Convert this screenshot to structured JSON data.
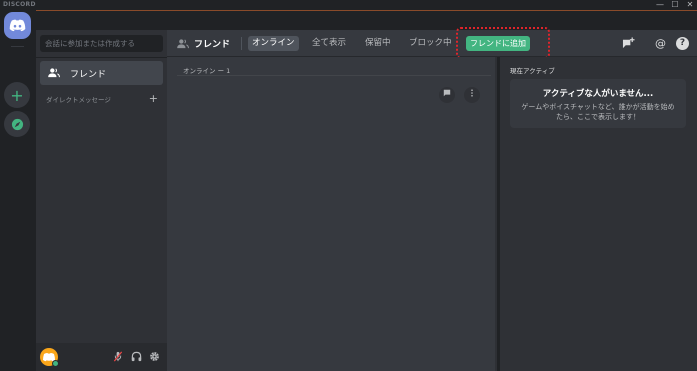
{
  "window": {
    "brand": "DISCORD",
    "minimize": "—",
    "maximize": "☐",
    "close": "✕"
  },
  "rail": {
    "add_server": "+",
    "explore": "⊘"
  },
  "sidebar": {
    "search_placeholder": "会話に参加または作成する",
    "friends_label": "フレンド",
    "dm_header": "ダイレクトメッセージ",
    "dm_add": "+"
  },
  "header": {
    "title": "フレンド",
    "tabs": [
      {
        "label": "オンライン",
        "active": true
      },
      {
        "label": "全て表示",
        "active": false
      },
      {
        "label": "保留中",
        "active": false
      },
      {
        "label": "ブロック中",
        "active": false
      }
    ],
    "add_friend": "フレンドに追加",
    "mention_icon": "@",
    "help_icon": "?"
  },
  "main": {
    "online_count": "オンライン ー 1"
  },
  "active_now": {
    "header": "現在アクティブ",
    "title": "アクティブな人がいません...",
    "description": "ゲームやボイスチャットなど、誰かが活動を始めたら、ここで表示します！"
  },
  "colors": {
    "blurple": "#7289da",
    "green": "#43b581",
    "highlight_red": "#e0242b",
    "avatar": "#faa61a"
  }
}
